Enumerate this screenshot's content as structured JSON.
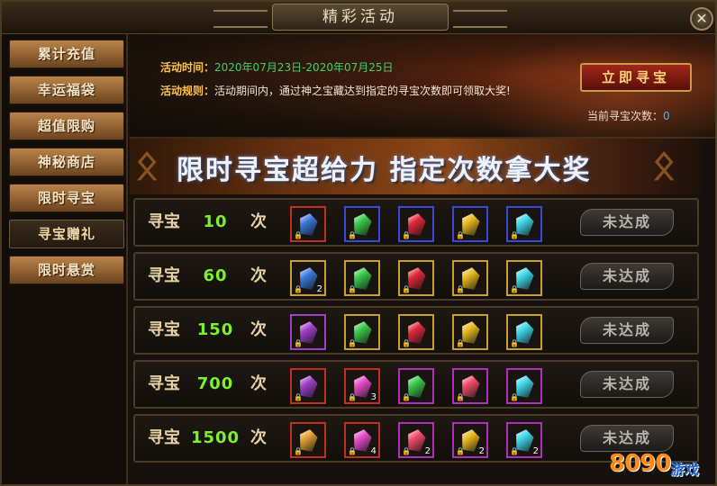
{
  "window": {
    "title": "精彩活动",
    "close_symbol": "✕"
  },
  "sidebar": {
    "items": [
      {
        "label": "累计充值",
        "active": false
      },
      {
        "label": "幸运福袋",
        "active": false
      },
      {
        "label": "超值限购",
        "active": false
      },
      {
        "label": "神秘商店",
        "active": false
      },
      {
        "label": "限时寻宝",
        "active": false
      },
      {
        "label": "寻宝赠礼",
        "active": true
      },
      {
        "label": "限时悬赏",
        "active": false
      }
    ]
  },
  "header": {
    "time_label": "活动时间：",
    "time_value": "2020年07月23日-2020年07月25日",
    "rule_label": "活动规则：",
    "rule_value": "活动期间内，通过神之宝藏达到指定的寻宝次数即可领取大奖!",
    "treasure_button": "立即寻宝",
    "count_label": "当前寻宝次数：",
    "count_value": "0"
  },
  "banner": {
    "text": "限时寻宝超给力 指定次数拿大奖"
  },
  "rows": [
    {
      "prefix": "寻宝",
      "count": "10",
      "suffix": "次",
      "status": "未达成",
      "items": [
        {
          "icon": "blue-bag-icon",
          "color": "#3a78d8",
          "border": "#c03020",
          "qty": ""
        },
        {
          "icon": "green-gem-icon",
          "color": "#3ac84a",
          "border": "#3a4ad8",
          "qty": ""
        },
        {
          "icon": "red-gem-icon",
          "color": "#e0283a",
          "border": "#3a4ad8",
          "qty": ""
        },
        {
          "icon": "gold-gem-icon",
          "color": "#e8b820",
          "border": "#3a4ad8",
          "qty": ""
        },
        {
          "icon": "cyan-gem-icon",
          "color": "#40d8e8",
          "border": "#3a4ad8",
          "qty": ""
        }
      ]
    },
    {
      "prefix": "寻宝",
      "count": "60",
      "suffix": "次",
      "status": "未达成",
      "items": [
        {
          "icon": "blue-bag-icon",
          "color": "#3a78d8",
          "border": "#c8a030",
          "qty": "2"
        },
        {
          "icon": "green-gem-icon",
          "color": "#3ac84a",
          "border": "#c8a030",
          "qty": ""
        },
        {
          "icon": "red-gem-icon",
          "color": "#e0283a",
          "border": "#c8a030",
          "qty": ""
        },
        {
          "icon": "gold-gem-icon",
          "color": "#e8b820",
          "border": "#c8a030",
          "qty": ""
        },
        {
          "icon": "cyan-gem-icon",
          "color": "#40d8e8",
          "border": "#c8a030",
          "qty": ""
        }
      ]
    },
    {
      "prefix": "寻宝",
      "count": "150",
      "suffix": "次",
      "status": "未达成",
      "items": [
        {
          "icon": "purple-chest-icon",
          "color": "#a040c8",
          "border": "#a040c8",
          "qty": ""
        },
        {
          "icon": "green-gem-icon",
          "color": "#3ac84a",
          "border": "#c8a030",
          "qty": ""
        },
        {
          "icon": "red-gem-icon",
          "color": "#e0283a",
          "border": "#c8a030",
          "qty": ""
        },
        {
          "icon": "gold-gem-icon",
          "color": "#e8b820",
          "border": "#c8a030",
          "qty": ""
        },
        {
          "icon": "cyan-gem-icon",
          "color": "#40d8e8",
          "border": "#c8a030",
          "qty": ""
        }
      ]
    },
    {
      "prefix": "寻宝",
      "count": "700",
      "suffix": "次",
      "status": "未达成",
      "items": [
        {
          "icon": "purple-chest-icon",
          "color": "#a040c8",
          "border": "#c03020",
          "qty": ""
        },
        {
          "icon": "rainbow-orb-icon",
          "color": "#e84ac8",
          "border": "#c03020",
          "qty": "3"
        },
        {
          "icon": "green-gem-icon",
          "color": "#3ac84a",
          "border": "#b030b8",
          "qty": ""
        },
        {
          "icon": "red-gem-icon",
          "color": "#f04a6a",
          "border": "#b030b8",
          "qty": ""
        },
        {
          "icon": "cyan-gem-icon",
          "color": "#40d8e8",
          "border": "#b030b8",
          "qty": ""
        }
      ]
    },
    {
      "prefix": "寻宝",
      "count": "1500",
      "suffix": "次",
      "status": "未达成",
      "items": [
        {
          "icon": "gold-chest-icon",
          "color": "#e0a030",
          "border": "#c03020",
          "qty": ""
        },
        {
          "icon": "rainbow-orb-icon",
          "color": "#e84ac8",
          "border": "#c03020",
          "qty": "4"
        },
        {
          "icon": "red-gem-icon",
          "color": "#f04a6a",
          "border": "#b030b8",
          "qty": "2"
        },
        {
          "icon": "gold-gem-icon",
          "color": "#e8b820",
          "border": "#b030b8",
          "qty": "2"
        },
        {
          "icon": "cyan-gem-icon",
          "color": "#40d8e8",
          "border": "#b030b8",
          "qty": "2"
        }
      ]
    }
  ],
  "watermark": {
    "text": "8090",
    "sub": "游戏"
  }
}
